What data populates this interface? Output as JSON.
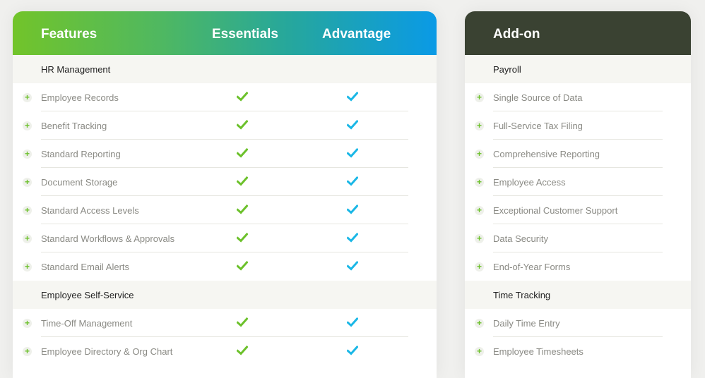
{
  "features_table": {
    "headers": {
      "features": "Features",
      "essentials": "Essentials",
      "advantage": "Advantage"
    },
    "check_colors": {
      "essentials": "#6cc12b",
      "advantage": "#1ab7e6"
    },
    "sections": [
      {
        "category": "HR Management",
        "items": [
          {
            "label": "Employee Records",
            "essentials": true,
            "advantage": true
          },
          {
            "label": "Benefit Tracking",
            "essentials": true,
            "advantage": true
          },
          {
            "label": "Standard Reporting",
            "essentials": true,
            "advantage": true
          },
          {
            "label": "Document Storage",
            "essentials": true,
            "advantage": true
          },
          {
            "label": "Standard Access Levels",
            "essentials": true,
            "advantage": true
          },
          {
            "label": "Standard Workflows & Approvals",
            "essentials": true,
            "advantage": true
          },
          {
            "label": "Standard Email Alerts",
            "essentials": true,
            "advantage": true
          }
        ]
      },
      {
        "category": "Employee Self-Service",
        "items": [
          {
            "label": "Time-Off Management",
            "essentials": true,
            "advantage": true
          },
          {
            "label": "Employee Directory & Org Chart",
            "essentials": true,
            "advantage": true
          }
        ]
      }
    ]
  },
  "addon_table": {
    "headers": {
      "addon": "Add-on"
    },
    "sections": [
      {
        "category": "Payroll",
        "items": [
          {
            "label": "Single Source of Data"
          },
          {
            "label": "Full-Service Tax Filing"
          },
          {
            "label": "Comprehensive Reporting"
          },
          {
            "label": "Employee Access"
          },
          {
            "label": "Exceptional Customer Support"
          },
          {
            "label": "Data Security"
          },
          {
            "label": "End-of-Year Forms"
          }
        ]
      },
      {
        "category": "Time Tracking",
        "items": [
          {
            "label": "Daily Time Entry"
          },
          {
            "label": "Employee Timesheets"
          }
        ]
      }
    ]
  },
  "icons": {
    "expand": "plus-icon",
    "included": "check-icon"
  }
}
